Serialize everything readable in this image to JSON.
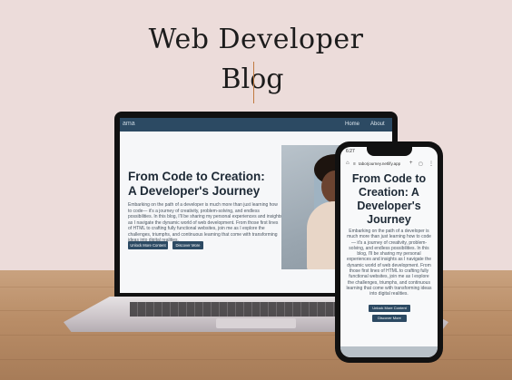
{
  "headline": {
    "line1": "Web Developer",
    "line2": "Blog"
  },
  "laptop": {
    "logo": "ama",
    "nav": [
      {
        "label": "Home"
      },
      {
        "label": "About"
      }
    ],
    "hero_title": "From Code to Creation: A Developer's Journey",
    "hero_text": "Embarking on the path of a developer is much more than just learning how to code— it's a journey of creativity, problem-solving, and endless possibilities. In this blog, I'll be sharing my personal experiences and insights as I navigate the dynamic world of web development. From those first lines of HTML to crafting fully functional websites, join me as I explore the challenges, triumphs, and continuous learning that come with transforming ideas into digital realities.",
    "buttons": {
      "unlock": "Unlock More Content",
      "discover": "Discover More"
    }
  },
  "phone": {
    "status_time": "6:27",
    "url": "taborjourney.netlify.app",
    "hero_title": "From Code to Creation: A Developer's Journey",
    "hero_text": "Embarking on the path of a developer is much more than just learning how to code— it's a journey of creativity, problem-solving, and endless possibilities. In this blog, I'll be sharing my personal experiences and insights as I navigate the dynamic world of web development. From those first lines of HTML to crafting fully functional websites, join me as I explore the challenges, triumphs, and continuous learning that come with transforming ideas into digital realities.",
    "buttons": {
      "unlock": "Unlock More Content",
      "discover": "Discover More"
    }
  },
  "colors": {
    "accent": "#2c4a63",
    "background": "#ecdcda"
  },
  "icons": [
    "home-icon",
    "tune-icon",
    "add-tab-icon",
    "tabs-icon",
    "menu-icon"
  ]
}
